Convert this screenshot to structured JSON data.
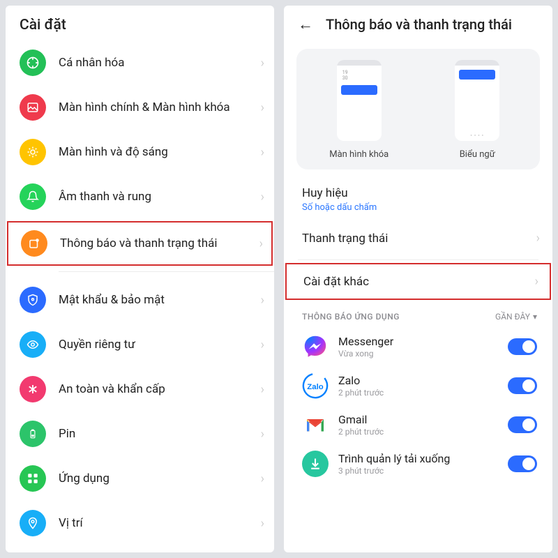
{
  "left": {
    "title": "Cài đặt",
    "items": [
      {
        "label": "Cá nhân hóa",
        "color": "#23c057"
      },
      {
        "label": "Màn hình chính & Màn hình khóa",
        "color": "#ef3a4c"
      },
      {
        "label": "Màn hình và độ sáng",
        "color": "#ffc400"
      },
      {
        "label": "Âm thanh và rung",
        "color": "#25d35a"
      },
      {
        "label": "Thông báo và thanh trạng thái",
        "color": "#ff8a1e",
        "highlight": true
      },
      {
        "label": "Mật khẩu & bảo mật",
        "color": "#2b6bff"
      },
      {
        "label": "Quyền riêng tư",
        "color": "#18aef7"
      },
      {
        "label": "An toàn và khẩn cấp",
        "color": "#f23a6f"
      },
      {
        "label": "Pin",
        "color": "#2cc46a"
      },
      {
        "label": "Ứng dụng",
        "color": "#27c654"
      },
      {
        "label": "Vị trí",
        "color": "#18aef7"
      }
    ]
  },
  "right": {
    "title": "Thông báo và thanh trạng thái",
    "preview": {
      "lock": "Màn hình khóa",
      "banner": "Biểu ngữ"
    },
    "badge": {
      "title": "Huy hiệu",
      "subtitle": "Số hoặc dấu chấm"
    },
    "status_bar": "Thanh trạng thái",
    "other_settings": "Cài đặt khác",
    "app_section": {
      "title": "THÔNG BÁO ỨNG DỤNG",
      "filter": "GẦN ĐÂY"
    },
    "apps": [
      {
        "name": "Messenger",
        "time": "Vừa xong"
      },
      {
        "name": "Zalo",
        "time": "2 phút trước"
      },
      {
        "name": "Gmail",
        "time": "2 phút trước"
      },
      {
        "name": "Trình quản lý tải xuống",
        "time": "3 phút trước"
      }
    ]
  }
}
